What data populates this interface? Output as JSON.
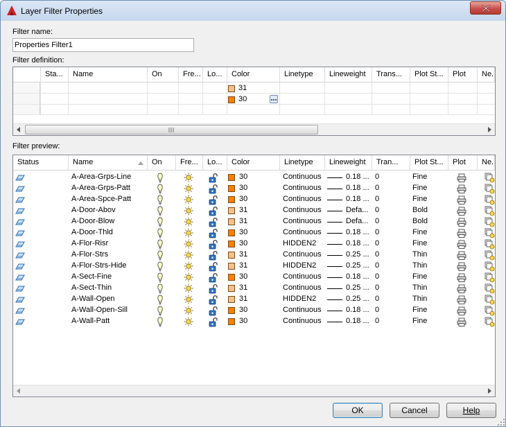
{
  "window": {
    "title": "Layer Filter Properties"
  },
  "filter_name": {
    "label": "Filter name:",
    "value": "Properties Filter1"
  },
  "definition": {
    "label": "Filter definition:",
    "columns": [
      "Sta...",
      "Name",
      "On",
      "Fre...",
      "Lo...",
      "Color",
      "Linetype",
      "Lineweight",
      "Trans...",
      "Plot St...",
      "Plot",
      "Ne."
    ],
    "color_values": [
      "31",
      "30"
    ],
    "color_swatches": [
      "#f5c08c",
      "#ff7f00"
    ]
  },
  "preview": {
    "label": "Filter preview:",
    "columns": [
      "Status",
      "Name",
      "On",
      "Fre...",
      "Lo...",
      "Color",
      "Linetype",
      "Lineweight",
      "Tran...",
      "Plot St...",
      "Plot",
      "Ne."
    ],
    "rows": [
      {
        "name": "A-Area-Grps-Line",
        "color": "30",
        "linetype": "Continuous",
        "lineweight": "0.18 ...",
        "trans": "0",
        "plotstyle": "Fine"
      },
      {
        "name": "A-Area-Grps-Patt",
        "color": "30",
        "linetype": "Continuous",
        "lineweight": "0.18 ...",
        "trans": "0",
        "plotstyle": "Fine"
      },
      {
        "name": "A-Area-Spce-Patt",
        "color": "30",
        "linetype": "Continuous",
        "lineweight": "0.18 ...",
        "trans": "0",
        "plotstyle": "Fine"
      },
      {
        "name": "A-Door-Abov",
        "color": "31",
        "linetype": "Continuous",
        "lineweight": "Defa...",
        "trans": "0",
        "plotstyle": "Bold"
      },
      {
        "name": "A-Door-Blow",
        "color": "31",
        "linetype": "Continuous",
        "lineweight": "Defa...",
        "trans": "0",
        "plotstyle": "Bold"
      },
      {
        "name": "A-Door-Thld",
        "color": "30",
        "linetype": "Continuous",
        "lineweight": "0.18 ...",
        "trans": "0",
        "plotstyle": "Fine"
      },
      {
        "name": "A-Flor-Risr",
        "color": "30",
        "linetype": "HIDDEN2",
        "lineweight": "0.18 ...",
        "trans": "0",
        "plotstyle": "Fine"
      },
      {
        "name": "A-Flor-Strs",
        "color": "31",
        "linetype": "Continuous",
        "lineweight": "0.25 ...",
        "trans": "0",
        "plotstyle": "Thin"
      },
      {
        "name": "A-Flor-Strs-Hide",
        "color": "31",
        "linetype": "HIDDEN2",
        "lineweight": "0.25 ...",
        "trans": "0",
        "plotstyle": "Thin"
      },
      {
        "name": "A-Sect-Fine",
        "color": "30",
        "linetype": "Continuous",
        "lineweight": "0.18 ...",
        "trans": "0",
        "plotstyle": "Fine"
      },
      {
        "name": "A-Sect-Thin",
        "color": "31",
        "linetype": "Continuous",
        "lineweight": "0.25 ...",
        "trans": "0",
        "plotstyle": "Thin"
      },
      {
        "name": "A-Wall-Open",
        "color": "31",
        "linetype": "HIDDEN2",
        "lineweight": "0.25 ...",
        "trans": "0",
        "plotstyle": "Thin"
      },
      {
        "name": "A-Wall-Open-Sill",
        "color": "30",
        "linetype": "Continuous",
        "lineweight": "0.18 ...",
        "trans": "0",
        "plotstyle": "Fine"
      },
      {
        "name": "A-Wall-Patt",
        "color": "30",
        "linetype": "Continuous",
        "lineweight": "0.18 ...",
        "trans": "0",
        "plotstyle": "Fine"
      }
    ],
    "color_map": {
      "30": "#ff7f00",
      "31": "#f5c08c"
    }
  },
  "buttons": {
    "ok": "OK",
    "cancel": "Cancel",
    "help": "Help"
  },
  "icons": {
    "status": "layer-status-icon",
    "on": "lightbulb-icon",
    "freeze": "sun-icon",
    "lock": "unlocked-padlock-icon",
    "plot": "printer-icon",
    "newvp": "new-viewport-freeze-icon"
  }
}
